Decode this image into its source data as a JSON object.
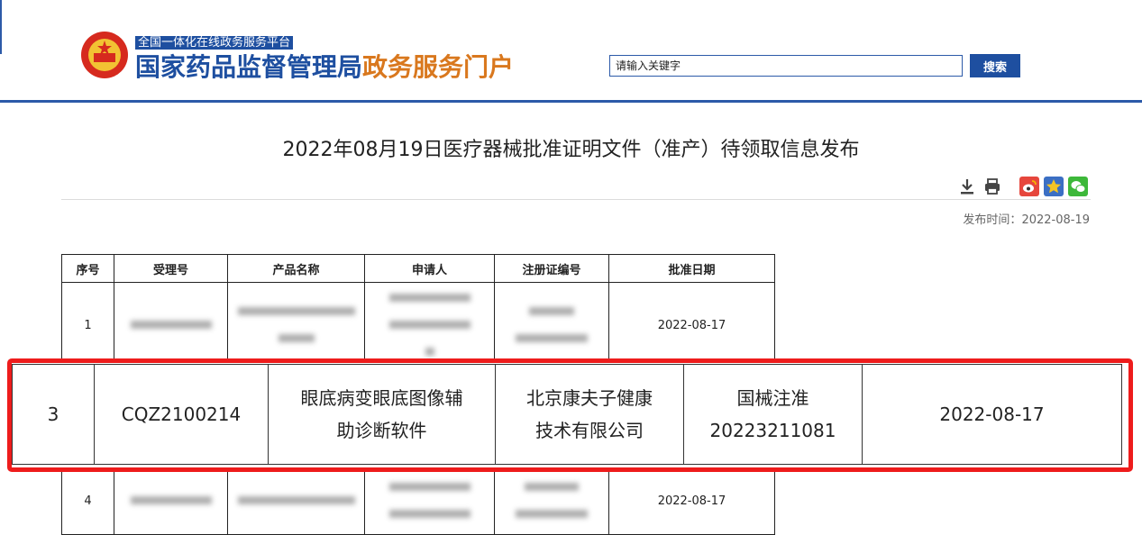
{
  "header": {
    "platform_tag": "全国一体化在线政务服务平台",
    "title_part1": "国家药品监督管理局",
    "title_part2": "政务服务门户",
    "search_placeholder": "请输入关键字",
    "search_button": "搜索",
    "colors": {
      "brand_blue": "#1e4fa0",
      "accent_orange": "#d9781e"
    }
  },
  "article": {
    "title": "2022年08月19日医疗器械批准证明文件（准产）待领取信息发布",
    "publish_label": "发布时间：",
    "publish_date": "2022-08-19",
    "tools": [
      "download-icon",
      "print-icon",
      "weibo-icon",
      "favorite-icon",
      "wechat-icon"
    ]
  },
  "table": {
    "headers": [
      "序号",
      "受理号",
      "产品名称",
      "申请人",
      "注册证编号",
      "批准日期"
    ],
    "rows": [
      {
        "no": "1",
        "date": "2022-08-17"
      },
      {
        "no": "4",
        "date": "2022-08-17"
      }
    ]
  },
  "highlight": {
    "color": "#ee1c1c",
    "no": "3",
    "accept_no": "CQZ2100214",
    "product_line1": "眼底病变眼底图像辅",
    "product_line2": "助诊断软件",
    "applicant_line1": "北京康夫子健康",
    "applicant_line2": "技术有限公司",
    "cert_line1": "国械注准",
    "cert_line2": "20223211081",
    "date": "2022-08-17"
  }
}
